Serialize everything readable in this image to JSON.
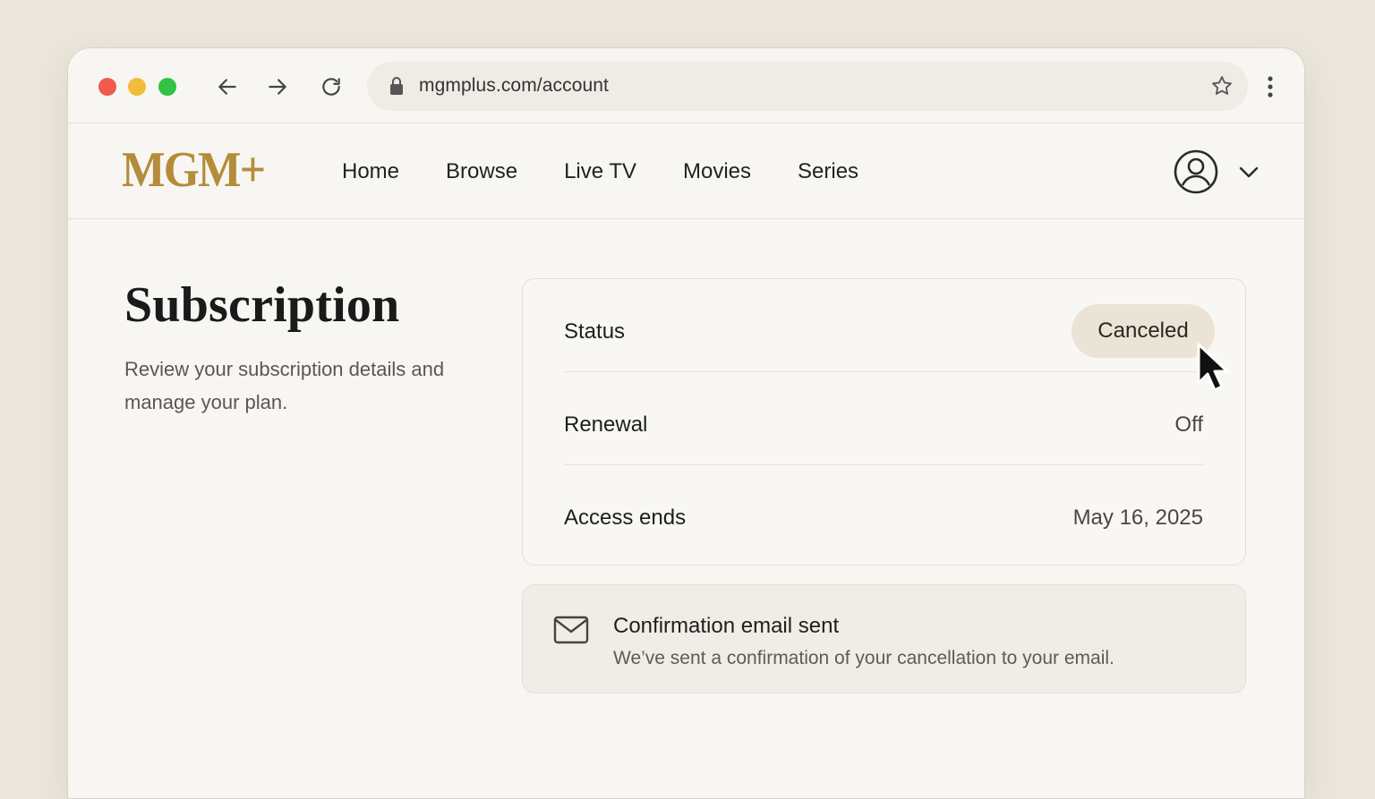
{
  "browser": {
    "url": "mgmplus.com/account",
    "icons": [
      "arrow-left-icon",
      "arrow-right-icon",
      "reload-icon",
      "lock-icon",
      "star-icon",
      "kebab-menu-icon"
    ]
  },
  "site": {
    "logo": "MGM+",
    "brand_color": "#b48c3a",
    "nav": [
      "Home",
      "Browse",
      "Live TV",
      "Movies",
      "Series"
    ]
  },
  "page": {
    "title": "Subscription",
    "subtitle": "Review your subscription details and manage your plan."
  },
  "subscription": {
    "status_label": "Status",
    "status_value": "Canceled",
    "renewal_label": "Renewal",
    "renewal_value": "Off",
    "access_label": "Access ends",
    "access_value": "May 16, 2025"
  },
  "notice": {
    "title": "Confirmation email sent",
    "text": "We’ve sent a confirmation of your cancellation to your email."
  }
}
